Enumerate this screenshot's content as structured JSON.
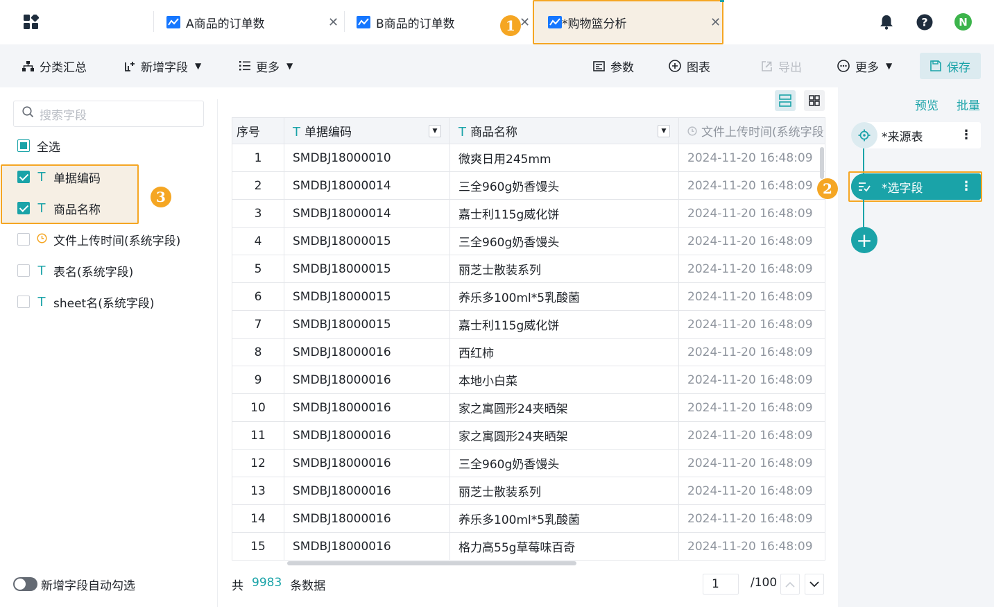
{
  "tabs": [
    {
      "label": "A商品的订单数"
    },
    {
      "label": "B商品的订单数"
    },
    {
      "label": "*购物篮分析"
    }
  ],
  "annotations": {
    "one": "1",
    "two": "2",
    "three": "3"
  },
  "avatar": {
    "letter": "N"
  },
  "toolbar": {
    "group": "分类汇总",
    "add_field": "新增字段",
    "more_left": "更多",
    "params": "参数",
    "chart": "图表",
    "export": "导出",
    "more_right": "更多",
    "save": "保存"
  },
  "left_panel": {
    "search_placeholder": "搜索字段",
    "select_all": "全选",
    "fields": [
      {
        "label": "单据编码",
        "checked": true
      },
      {
        "label": "商品名称",
        "checked": true
      },
      {
        "label": "文件上传时间(系统字段)",
        "checked": false
      },
      {
        "label": "表名(系统字段)",
        "checked": false
      },
      {
        "label": "sheet名(系统字段)",
        "checked": false
      }
    ],
    "auto_select_label": "新增字段自动勾选"
  },
  "table": {
    "columns": [
      "序号",
      "单据编码",
      "商品名称",
      "文件上传时间(系统字段)"
    ],
    "rows": [
      [
        "1",
        "SMDBJ18000010",
        "微爽日用245mm",
        "2024-11-20 16:48:09"
      ],
      [
        "2",
        "SMDBJ18000014",
        "三全960g奶香馒头",
        "2024-11-20 16:48:09"
      ],
      [
        "3",
        "SMDBJ18000014",
        "嘉士利115g威化饼",
        "2024-11-20 16:48:09"
      ],
      [
        "4",
        "SMDBJ18000015",
        "三全960g奶香馒头",
        "2024-11-20 16:48:09"
      ],
      [
        "5",
        "SMDBJ18000015",
        "丽芝士散装系列",
        "2024-11-20 16:48:09"
      ],
      [
        "6",
        "SMDBJ18000015",
        "养乐多100ml*5乳酸菌",
        "2024-11-20 16:48:09"
      ],
      [
        "7",
        "SMDBJ18000015",
        "嘉士利115g威化饼",
        "2024-11-20 16:48:09"
      ],
      [
        "8",
        "SMDBJ18000016",
        "西红柿",
        "2024-11-20 16:48:09"
      ],
      [
        "9",
        "SMDBJ18000016",
        "本地小白菜",
        "2024-11-20 16:48:09"
      ],
      [
        "10",
        "SMDBJ18000016",
        "家之寓圆形24夹晒架",
        "2024-11-20 16:48:09"
      ],
      [
        "11",
        "SMDBJ18000016",
        "家之寓圆形24夹晒架",
        "2024-11-20 16:48:09"
      ],
      [
        "12",
        "SMDBJ18000016",
        "三全960g奶香馒头",
        "2024-11-20 16:48:09"
      ],
      [
        "13",
        "SMDBJ18000016",
        "丽芝士散装系列",
        "2024-11-20 16:48:09"
      ],
      [
        "14",
        "SMDBJ18000016",
        "养乐多100ml*5乳酸菌",
        "2024-11-20 16:48:09"
      ],
      [
        "15",
        "SMDBJ18000016",
        "格力高55g草莓味百奇",
        "2024-11-20 16:48:09"
      ]
    ]
  },
  "footer": {
    "total_prefix": "共",
    "total_count": "9983",
    "total_suffix": "条数据",
    "page_value": "1",
    "page_total": "/100"
  },
  "right_panel": {
    "preview": "预览",
    "batch": "批量",
    "nodes": [
      {
        "label": "*来源表"
      },
      {
        "label": "*选字段"
      }
    ]
  },
  "colors": {
    "accent": "#1aa3a8",
    "highlight": "#f5a623",
    "toolbar_bg": "#f3f5f8"
  }
}
